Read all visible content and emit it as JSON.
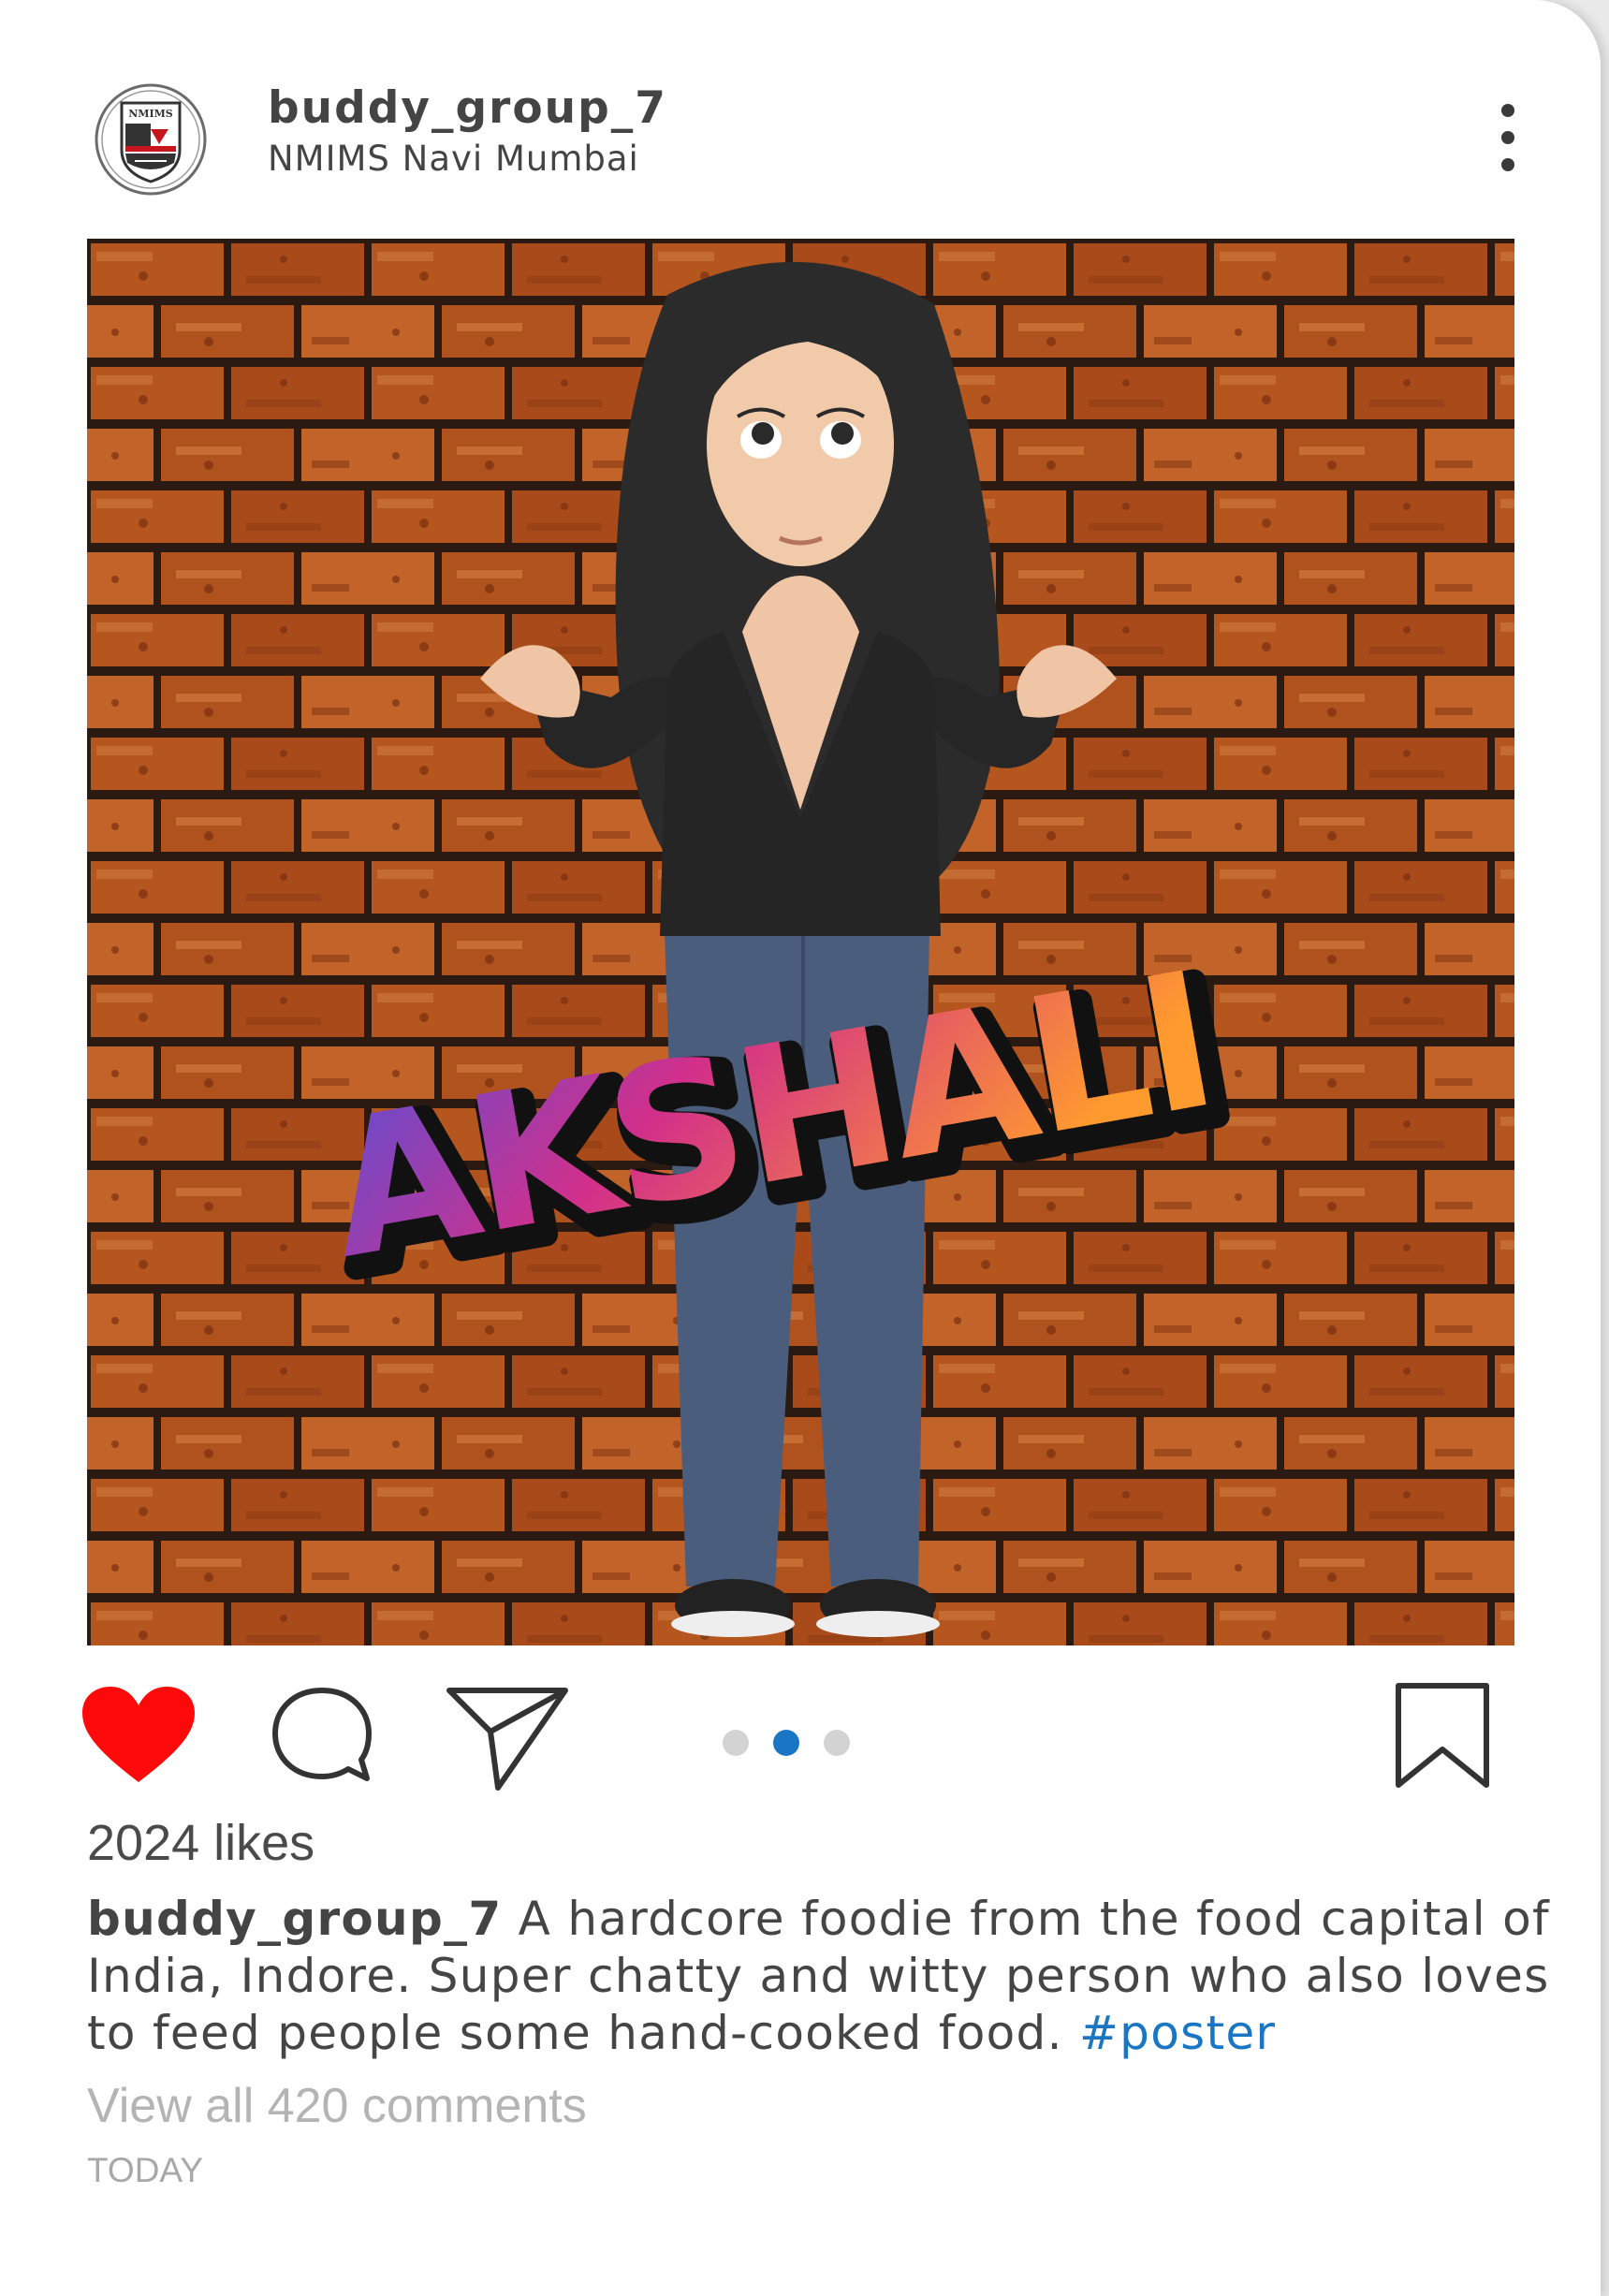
{
  "post": {
    "username": "buddy_group_7",
    "location": "NMIMS Navi Mumbai",
    "avatar": {
      "icon": "nmims-logo",
      "logo_text": "NMIMS",
      "logo_subtext": "Deemed to be UNIVERSITY"
    },
    "more_icon": "more-vertical-icon",
    "image": {
      "sticker_text": "AKSHALI",
      "background": "brick-wall",
      "subject": "bitmoji-avatar"
    },
    "carousel": {
      "count": 3,
      "active_index": 1
    },
    "actions": {
      "like_icon": "heart-icon",
      "liked": true,
      "comment_icon": "comment-icon",
      "share_icon": "send-icon",
      "save_icon": "bookmark-icon"
    },
    "likes_text": "2024 likes",
    "caption": {
      "username": "buddy_group_7",
      "text": " A hardcore foodie from the food capital of India, Indore. Super chatty and witty person who also loves to feed people some hand-cooked food. ",
      "hashtag": "#poster"
    },
    "view_comments_text": "View all 420 comments",
    "timestamp": "TODAY"
  },
  "colors": {
    "like_red": "#ff0a0a",
    "link_blue": "#1a75c4",
    "active_dot": "#1a75c4",
    "inactive_dot": "#d3d3d3",
    "text_dark": "#444444",
    "text_muted": "#b4b4b4"
  }
}
